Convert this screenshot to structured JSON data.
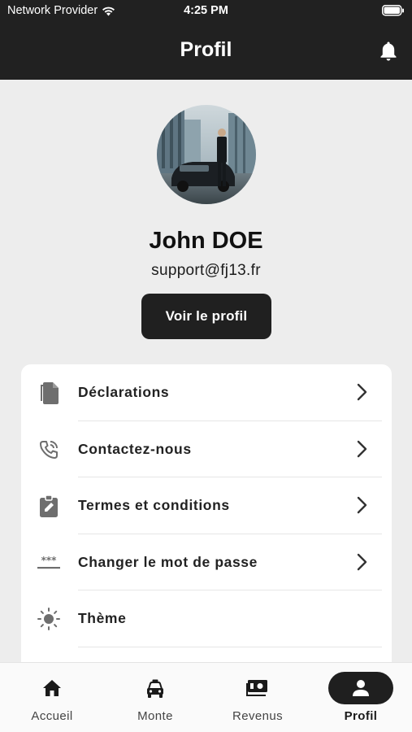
{
  "status_bar": {
    "carrier": "Network Provider",
    "time": "4:25 PM"
  },
  "header": {
    "title": "Profil"
  },
  "profile": {
    "name": "John DOE",
    "email": "support@fj13.fr",
    "view_profile_label": "Voir le profil"
  },
  "menu": {
    "items": [
      {
        "label": "Déclarations",
        "icon": "file-copy-icon"
      },
      {
        "label": "Contactez-nous",
        "icon": "phone-call-icon"
      },
      {
        "label": "Termes et conditions",
        "icon": "clipboard-edit-icon"
      },
      {
        "label": "Changer le mot de passe",
        "icon": "password-icon"
      },
      {
        "label": "Thème",
        "icon": "sun-icon"
      }
    ]
  },
  "tabs": [
    {
      "label": "Accueil",
      "icon": "home-icon"
    },
    {
      "label": "Monte",
      "icon": "taxi-icon"
    },
    {
      "label": "Revenus",
      "icon": "money-icon"
    },
    {
      "label": "Profil",
      "icon": "person-icon",
      "active": true
    }
  ],
  "colors": {
    "header_bg": "#212121",
    "page_bg": "#ededed",
    "button_bg": "#202020",
    "accent_pill": "#1f1f1f"
  }
}
